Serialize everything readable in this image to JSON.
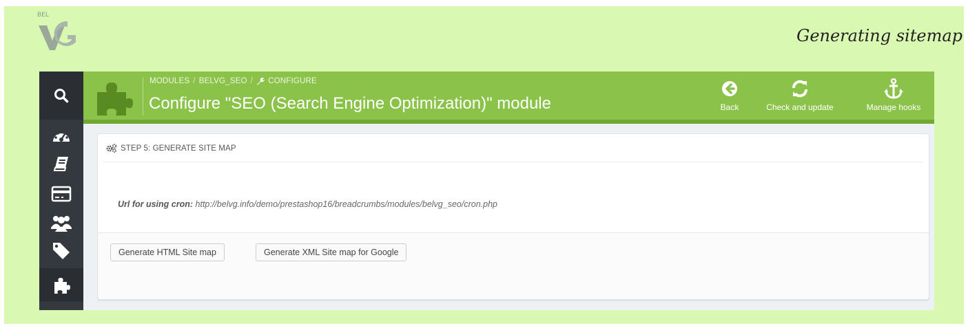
{
  "heading": "Generating sitemap",
  "logo": {
    "small_text": "BEL"
  },
  "breadcrumb": {
    "items": [
      "MODULES",
      "BELVG_SEO",
      "CONFIGURE"
    ],
    "separator": "/"
  },
  "toolbar": {
    "title": "Configure \"SEO (Search Engine Optimization)\" module",
    "buttons": [
      {
        "label": "Back",
        "icon": "arrow-left-circle-icon"
      },
      {
        "label": "Check and update",
        "icon": "refresh-icon"
      },
      {
        "label": "Manage hooks",
        "icon": "anchor-icon"
      }
    ]
  },
  "sidebar": {
    "items": [
      {
        "icon": "search-icon"
      },
      {
        "icon": "dashboard-icon"
      },
      {
        "icon": "catalog-book-icon"
      },
      {
        "icon": "credit-card-icon"
      },
      {
        "icon": "customers-icon"
      },
      {
        "icon": "price-tags-icon"
      },
      {
        "icon": "puzzle-icon",
        "active": true
      }
    ]
  },
  "panel": {
    "title": "STEP 5: GENERATE SITE MAP",
    "cron_label": "Url for using cron:",
    "cron_url": "http://belvg.info/demo/prestashop16/breadcrumbs/modules/belvg_seo/cron.php",
    "buttons": {
      "html": "Generate HTML Site map",
      "xml": "Generate XML Site map for Google"
    }
  },
  "colors": {
    "frame_bg": "#d9f9b3",
    "toolbar_green": "#8bc34a",
    "sidebar_dark": "#34393f"
  }
}
